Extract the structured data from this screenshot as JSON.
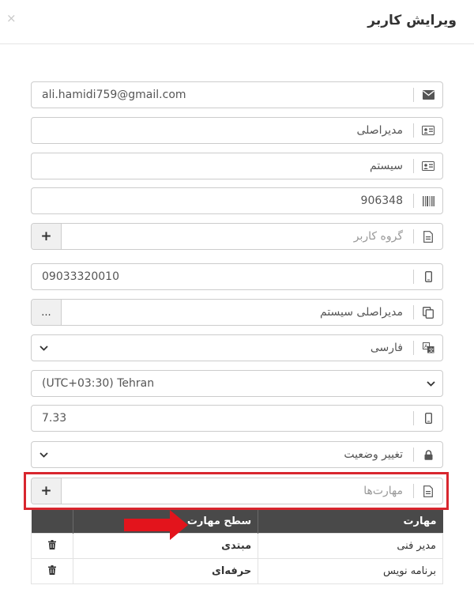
{
  "dialog": {
    "title": "ویرایش کاربر",
    "close_label": "×"
  },
  "form": {
    "email": "ali.hamidi759@gmail.com",
    "first_name": "مدیراصلی",
    "last_name": "سیستم",
    "personnel_code": "906348",
    "user_group_placeholder": "گروه کاربر",
    "user_group_add": "+",
    "mobile": "09033320010",
    "manager": "مدیراصلی سیستم",
    "manager_browse": "...",
    "language": "فارسی",
    "timezone": "(UTC+03:30) Tehran",
    "number_value": "7.33",
    "status": "تغییر وضعیت",
    "skills_placeholder": "مهارت‌ها",
    "skills_add": "+"
  },
  "skills_table": {
    "headers": {
      "skill": "مهارت",
      "level": "سطح مهارت",
      "action": ""
    },
    "rows": [
      {
        "skill": "مدیر فنی",
        "level": "مبتدی"
      },
      {
        "skill": "برنامه نویس",
        "level": "حرفه‌ای"
      }
    ]
  },
  "colors": {
    "highlight": "#d8262e",
    "table_header_bg": "#494949",
    "arrow": "#e3141c"
  },
  "icons": {
    "email": "envelope-icon",
    "first_name": "id-card-icon",
    "last_name": "id-card-icon",
    "personnel_code": "barcode-icon",
    "user_group": "document-icon",
    "mobile": "mobile-icon",
    "manager": "copy-icon",
    "language": "translate-icon",
    "number": "mobile-icon",
    "status": "lock-icon",
    "skills": "document-icon",
    "delete": "trash-icon"
  }
}
